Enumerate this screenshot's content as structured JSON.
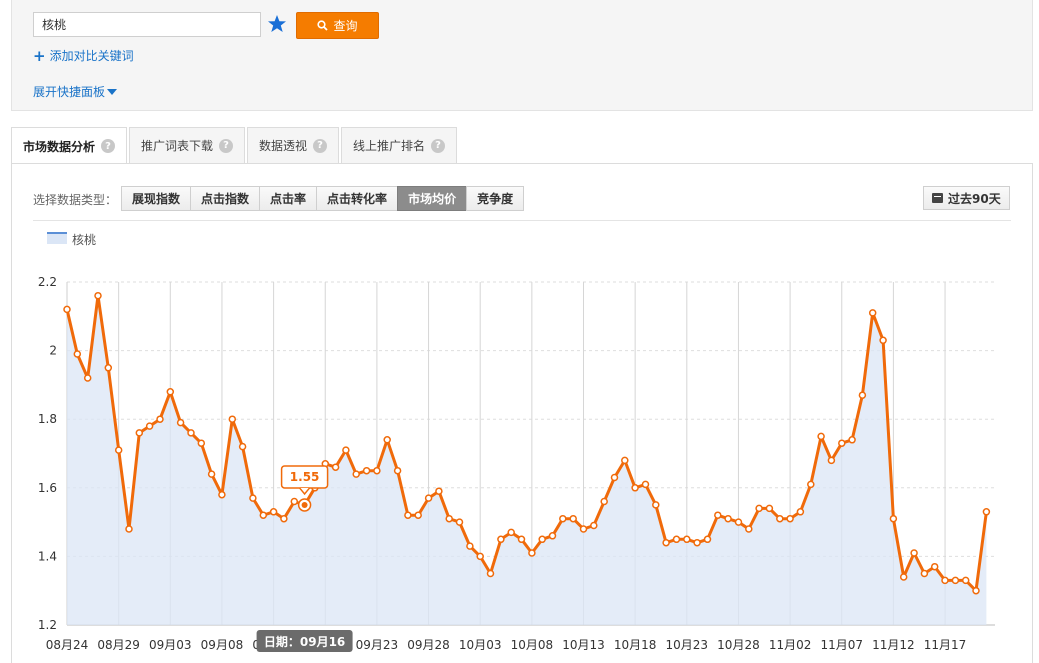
{
  "search": {
    "value": "核桃"
  },
  "query_button": {
    "label": "查询"
  },
  "add_compare": {
    "label": "添加对比关键词"
  },
  "expand_panel": {
    "label": "展开快捷面板"
  },
  "tabs": [
    {
      "label": "市场数据分析",
      "active": true
    },
    {
      "label": "推广词表下载",
      "active": false
    },
    {
      "label": "数据透视",
      "active": false
    },
    {
      "label": "线上推广排名",
      "active": false
    }
  ],
  "type_selector": {
    "label": "选择数据类型：",
    "options": [
      "展现指数",
      "点击指数",
      "点击率",
      "点击转化率",
      "市场均价",
      "竞争度"
    ],
    "selected": "市场均价"
  },
  "range_button": {
    "label": "过去90天"
  },
  "colors": {
    "accent": "#f57c00",
    "link": "#1a73c8",
    "line": "#f06a0a",
    "area": "#dbe6f6"
  },
  "chart_data": {
    "type": "area",
    "legend": [
      "核桃"
    ],
    "ylim": [
      1.2,
      2.2
    ],
    "yticks": [
      "1.2",
      "1.4",
      "1.6",
      "1.8",
      "2",
      "2.2"
    ],
    "xtick_labels": [
      "08月24",
      "08月29",
      "09月03",
      "09月08",
      "09月13",
      "09月18",
      "09月23",
      "09月28",
      "10月03",
      "10月08",
      "10月13",
      "10月18",
      "10月23",
      "10月28",
      "11月02",
      "11月07",
      "11月12",
      "11月17"
    ],
    "series": [
      {
        "name": "核桃",
        "values": [
          2.12,
          1.99,
          1.92,
          2.16,
          1.95,
          1.71,
          1.48,
          1.76,
          1.78,
          1.8,
          1.88,
          1.79,
          1.76,
          1.73,
          1.64,
          1.58,
          1.8,
          1.72,
          1.57,
          1.52,
          1.53,
          1.51,
          1.56,
          1.55,
          1.6,
          1.67,
          1.66,
          1.71,
          1.64,
          1.65,
          1.65,
          1.74,
          1.65,
          1.52,
          1.52,
          1.57,
          1.59,
          1.51,
          1.5,
          1.43,
          1.4,
          1.35,
          1.45,
          1.47,
          1.45,
          1.41,
          1.45,
          1.46,
          1.51,
          1.51,
          1.48,
          1.49,
          1.56,
          1.63,
          1.68,
          1.6,
          1.61,
          1.55,
          1.44,
          1.45,
          1.45,
          1.44,
          1.45,
          1.52,
          1.51,
          1.5,
          1.48,
          1.54,
          1.54,
          1.51,
          1.51,
          1.53,
          1.61,
          1.75,
          1.68,
          1.73,
          1.74,
          1.87,
          2.11,
          2.03,
          1.51,
          1.34,
          1.41,
          1.35,
          1.37,
          1.33,
          1.33,
          1.33,
          1.3,
          1.53
        ]
      }
    ],
    "tooltip": {
      "value": "1.55"
    },
    "crosshair": {
      "label": "日期：09月16"
    }
  }
}
